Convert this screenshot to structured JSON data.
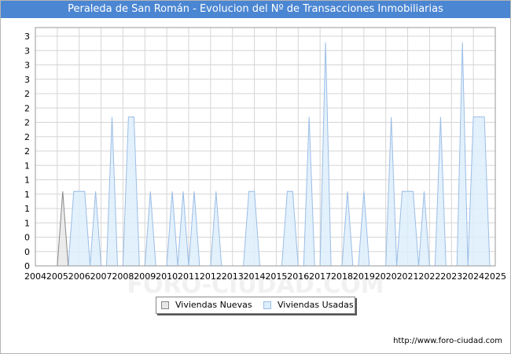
{
  "title": "Peraleda de San Román - Evolucion del Nº de Transacciones Inmobiliarias",
  "source": "http://www.foro-ciudad.com",
  "watermark": "FORO-CIUDAD.COM",
  "colors": {
    "title_bg": "#4b86d2",
    "nuevas_line": "#888888",
    "nuevas_fill": "#e8e8e8",
    "usadas_line": "#9cbde6",
    "usadas_fill": "#ddeefc",
    "grid": "#d5d5d5"
  },
  "chart_data": {
    "type": "area",
    "title": "Peraleda de San Román - Evolucion del Nº de Transacciones Inmobiliarias",
    "x_tick_labels": [
      "2004",
      "2005",
      "2006",
      "2007",
      "2008",
      "2009",
      "2010",
      "2011",
      "2012",
      "2013",
      "2014",
      "2015",
      "2016",
      "2017",
      "2018",
      "2019",
      "2020",
      "2021",
      "2022",
      "2023",
      "2024",
      "2025"
    ],
    "y_tick_labels": [
      "0",
      "0",
      "0",
      "1",
      "1",
      "1",
      "1",
      "1",
      "2",
      "2",
      "2",
      "2",
      "2",
      "3",
      "3",
      "3",
      "3"
    ],
    "y_range": [
      0,
      3.2
    ],
    "x_range": [
      2004,
      2025
    ],
    "grid": true,
    "legend_position": "bottom",
    "series": [
      {
        "name": "Viviendas Nuevas",
        "points": [
          [
            2004,
            0
          ],
          [
            2005.0,
            0
          ],
          [
            2005.25,
            1
          ],
          [
            2005.5,
            0
          ],
          [
            2025,
            0
          ]
        ]
      },
      {
        "name": "Viviendas Usadas",
        "points": [
          [
            2004,
            0
          ],
          [
            2005.5,
            0
          ],
          [
            2005.75,
            1
          ],
          [
            2006.25,
            1
          ],
          [
            2006.5,
            0
          ],
          [
            2006.75,
            1
          ],
          [
            2007.0,
            0
          ],
          [
            2007.25,
            0
          ],
          [
            2007.5,
            2
          ],
          [
            2007.75,
            0
          ],
          [
            2008.0,
            0
          ],
          [
            2008.25,
            2
          ],
          [
            2008.5,
            2
          ],
          [
            2008.75,
            0
          ],
          [
            2009.0,
            0
          ],
          [
            2009.25,
            1
          ],
          [
            2009.5,
            0
          ],
          [
            2010.0,
            0
          ],
          [
            2010.25,
            1
          ],
          [
            2010.5,
            0
          ],
          [
            2010.75,
            1
          ],
          [
            2011.0,
            0
          ],
          [
            2011.25,
            1
          ],
          [
            2011.5,
            0
          ],
          [
            2012.0,
            0
          ],
          [
            2012.25,
            1
          ],
          [
            2012.5,
            0
          ],
          [
            2013.5,
            0
          ],
          [
            2013.75,
            1
          ],
          [
            2014.0,
            1
          ],
          [
            2014.25,
            0
          ],
          [
            2015.25,
            0
          ],
          [
            2015.5,
            1
          ],
          [
            2015.75,
            1
          ],
          [
            2016.0,
            0
          ],
          [
            2016.25,
            0
          ],
          [
            2016.5,
            2
          ],
          [
            2016.75,
            0
          ],
          [
            2017.0,
            0
          ],
          [
            2017.25,
            3
          ],
          [
            2017.5,
            0
          ],
          [
            2018.0,
            0
          ],
          [
            2018.25,
            1
          ],
          [
            2018.5,
            0
          ],
          [
            2018.75,
            0
          ],
          [
            2019.0,
            1
          ],
          [
            2019.25,
            0
          ],
          [
            2020.0,
            0
          ],
          [
            2020.25,
            2
          ],
          [
            2020.5,
            0
          ],
          [
            2020.75,
            1
          ],
          [
            2021.25,
            1
          ],
          [
            2021.5,
            0
          ],
          [
            2021.75,
            1
          ],
          [
            2022.0,
            0
          ],
          [
            2022.25,
            0
          ],
          [
            2022.5,
            2
          ],
          [
            2022.75,
            0
          ],
          [
            2023.25,
            0
          ],
          [
            2023.5,
            3
          ],
          [
            2023.75,
            0
          ],
          [
            2024.0,
            2
          ],
          [
            2024.5,
            2
          ],
          [
            2024.75,
            0
          ]
        ]
      }
    ]
  }
}
